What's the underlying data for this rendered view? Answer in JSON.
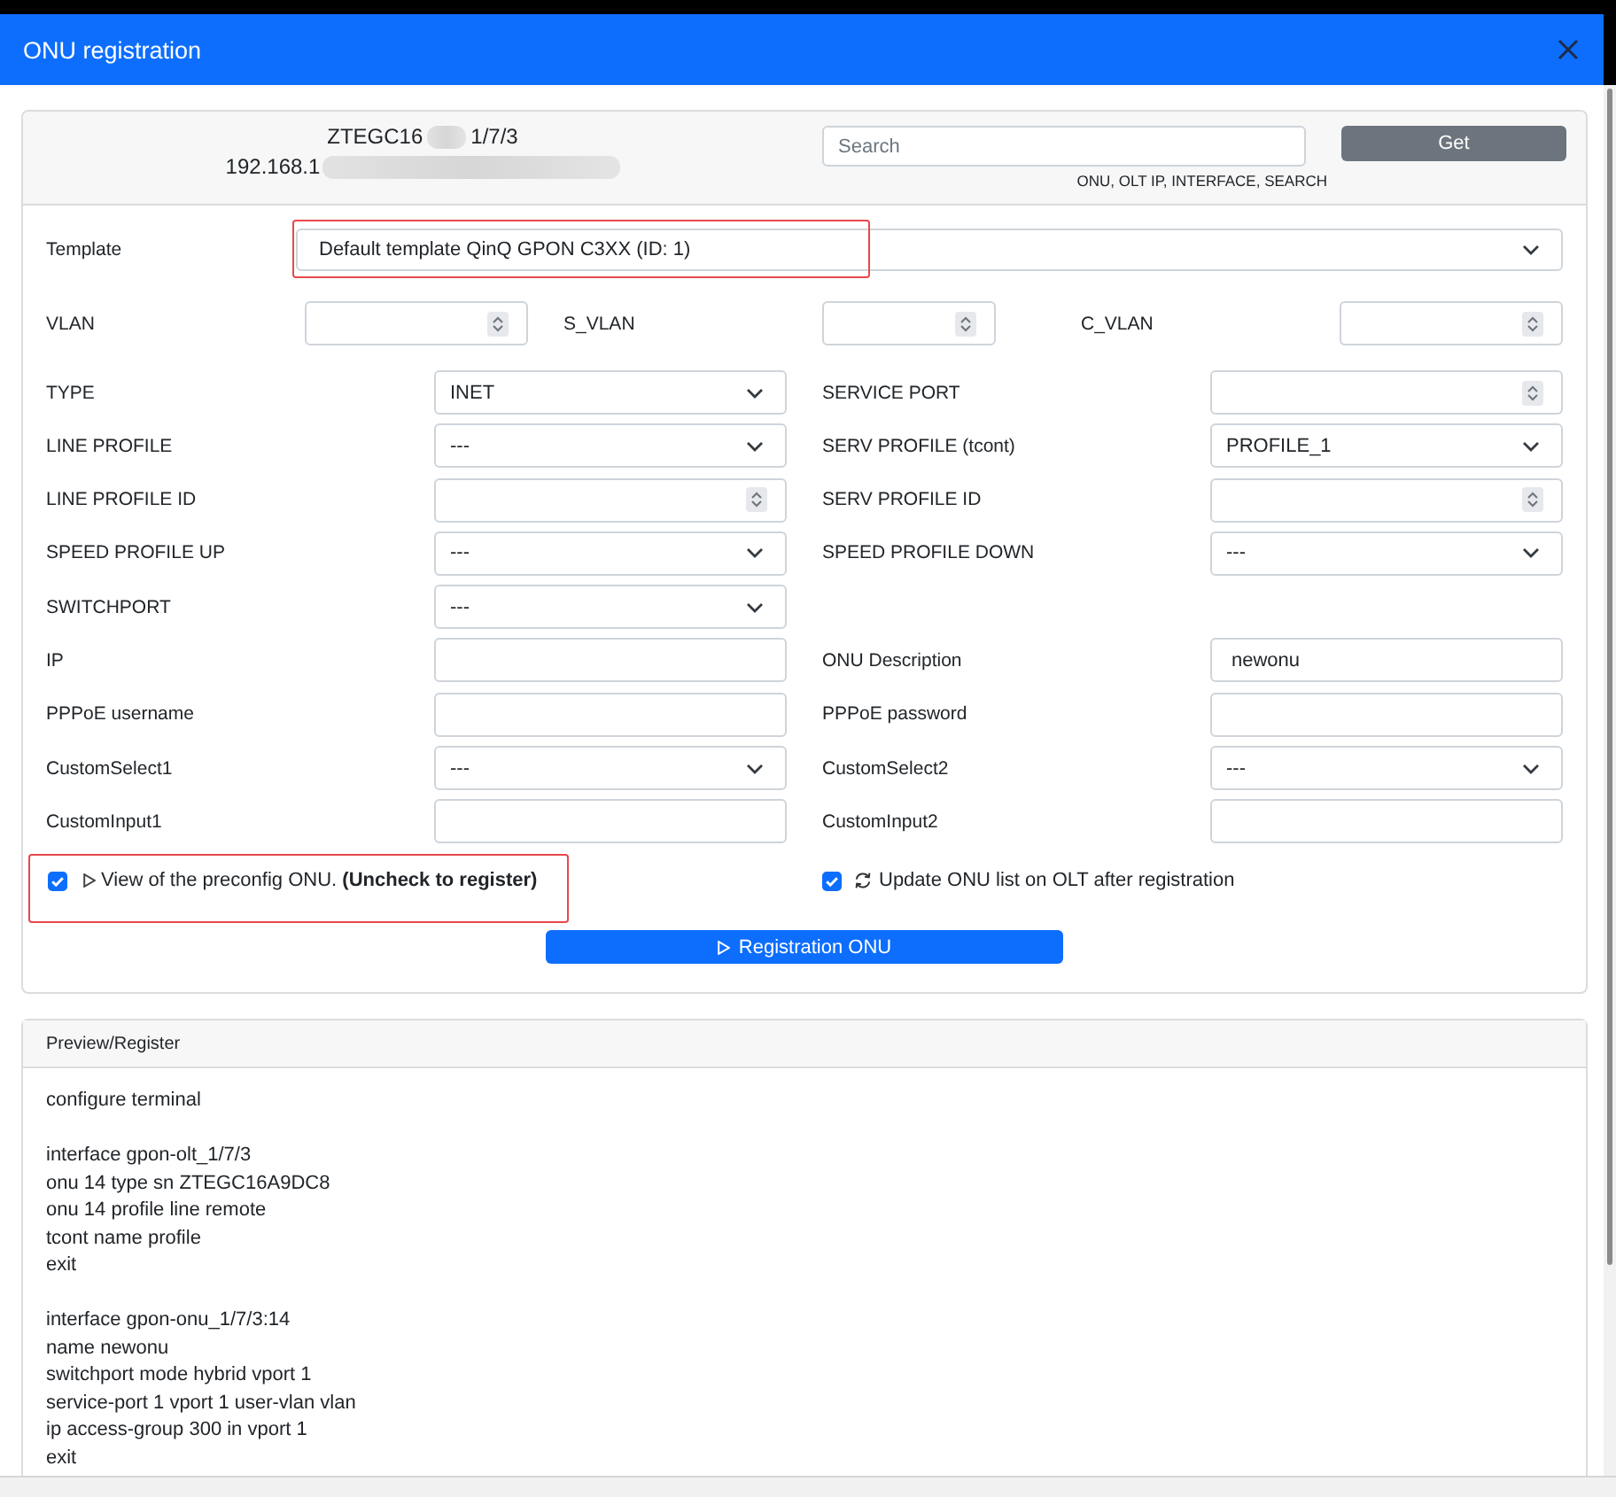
{
  "dialog": {
    "title": "ONU registration"
  },
  "device": {
    "serial": {
      "text": "ZTEGC16",
      "redacted": true,
      "port": "1/7/3"
    },
    "address": {
      "text": "192.168.1",
      "redacted": true
    }
  },
  "search": {
    "placeholder": "Search",
    "hint": "ONU, OLT IP, INTERFACE, SEARCH",
    "button": "Get"
  },
  "template": {
    "label": "Template",
    "value": "Default template QinQ GPON C3XX (ID: 1)",
    "highlighted": true
  },
  "vlan_fields": [
    {
      "label": "VLAN",
      "kind": "number"
    },
    {
      "label": "S_VLAN",
      "kind": "number"
    },
    {
      "label": "C_VLAN",
      "kind": "number"
    }
  ],
  "rows": [
    {
      "cells": [
        {
          "label": "TYPE",
          "kind": "select",
          "value": "INET"
        },
        {
          "label": "SERVICE PORT",
          "kind": "number"
        }
      ]
    },
    {
      "cells": [
        {
          "label": "LINE PROFILE",
          "kind": "select",
          "value": "---"
        },
        {
          "label": "SERV PROFILE (tcont)",
          "kind": "select",
          "value": "PROFILE_1"
        }
      ]
    },
    {
      "cells": [
        {
          "label": "LINE PROFILE ID",
          "kind": "number"
        },
        {
          "label": "SERV PROFILE ID",
          "kind": "number"
        }
      ]
    },
    {
      "cells": [
        {
          "label": "SPEED PROFILE UP",
          "kind": "select",
          "value": "---"
        },
        {
          "label": "SPEED PROFILE DOWN",
          "kind": "select",
          "value": "---"
        }
      ]
    },
    {
      "cells": [
        {
          "label": "SWITCHPORT",
          "kind": "select",
          "value": "---"
        }
      ]
    },
    {
      "cells": [
        {
          "label": "IP",
          "kind": "text"
        },
        {
          "label": "ONU Description",
          "kind": "text",
          "value": "newonu"
        }
      ]
    },
    {
      "cells": [
        {
          "label": "PPPoE username",
          "kind": "text"
        },
        {
          "label": "PPPoE password",
          "kind": "text"
        }
      ]
    },
    {
      "cells": [
        {
          "label": "CustomSelect1",
          "kind": "select",
          "value": "---"
        },
        {
          "label": "CustomSelect2",
          "kind": "select",
          "value": "---"
        }
      ]
    },
    {
      "cells": [
        {
          "label": "CustomInput1",
          "kind": "text"
        },
        {
          "label": "CustomInput2",
          "kind": "text"
        }
      ]
    }
  ],
  "options": [
    {
      "kind": "preview",
      "checked": true,
      "text": "View of the preconfig ONU. **(Uncheck to register)**",
      "highlighted": true
    },
    {
      "kind": "update",
      "checked": true,
      "text": "Update ONU list on OLT after registration",
      "highlighted": false
    }
  ],
  "register_button": {
    "label": "Registration ONU"
  },
  "preview": {
    "title": "Preview/Register",
    "blocks": [
      [
        "configure terminal"
      ],
      [
        "interface gpon-olt_1/7/3",
        "onu 14 type sn ZTEGC16A9DC8",
        "onu 14 profile line remote",
        "tcont name profile",
        "exit"
      ],
      [
        "interface gpon-onu_1/7/3:14",
        "name newonu",
        "switchport mode hybrid vport 1",
        "service-port 1 vport 1 user-vlan vlan",
        "ip access-group 300 in vport 1",
        "exit"
      ]
    ]
  }
}
